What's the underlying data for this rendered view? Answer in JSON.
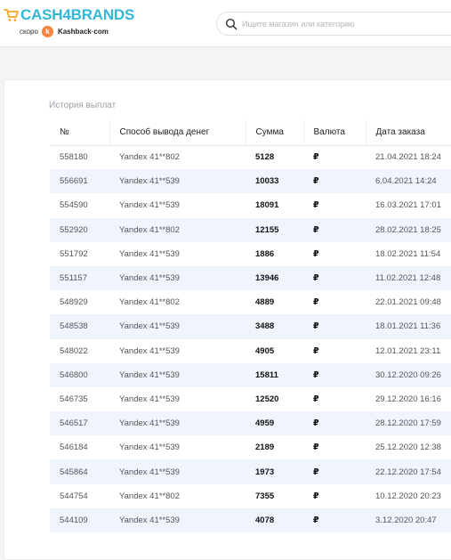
{
  "brand": {
    "name": "CASH4BRANDS",
    "soon_label": "скоро",
    "k_letter": "k",
    "kashback_label": "Kashback·com",
    "color": "#34b6d8"
  },
  "search": {
    "placeholder": "Ищите магазин или категорию"
  },
  "payouts": {
    "title": "История выплат",
    "columns": [
      "№",
      "Способ вывода денег",
      "Сумма",
      "Валюта",
      "Дата заказа"
    ],
    "rows": [
      [
        "558180",
        "Yandex 41**802",
        "5128",
        "₽",
        "21.04.2021 18:24"
      ],
      [
        "556691",
        "Yandex 41**539",
        "10033",
        "₽",
        "6.04.2021 14:24"
      ],
      [
        "554590",
        "Yandex 41**539",
        "18091",
        "₽",
        "16.03.2021 17:01"
      ],
      [
        "552920",
        "Yandex 41**802",
        "12155",
        "₽",
        "28.02.2021 18:25"
      ],
      [
        "551792",
        "Yandex 41**539",
        "1886",
        "₽",
        "18.02.2021 11:54"
      ],
      [
        "551157",
        "Yandex 41**539",
        "13946",
        "₽",
        "11.02.2021 12:48"
      ],
      [
        "548929",
        "Yandex 41**802",
        "4889",
        "₽",
        "22.01.2021 09:48"
      ],
      [
        "548538",
        "Yandex 41**539",
        "3488",
        "₽",
        "18.01.2021 11:36"
      ],
      [
        "548022",
        "Yandex 41**539",
        "4905",
        "₽",
        "12.01.2021 23:11"
      ],
      [
        "546800",
        "Yandex 41**539",
        "15811",
        "₽",
        "30.12.2020 09:26"
      ],
      [
        "546735",
        "Yandex 41**539",
        "12520",
        "₽",
        "29.12.2020 16:16"
      ],
      [
        "546517",
        "Yandex 41**539",
        "4959",
        "₽",
        "28.12.2020 17:59"
      ],
      [
        "546184",
        "Yandex 41**539",
        "2189",
        "₽",
        "25.12.2020 12:38"
      ],
      [
        "545864",
        "Yandex 41**539",
        "1973",
        "₽",
        "22.12.2020 17:54"
      ],
      [
        "544754",
        "Yandex 41**802",
        "7355",
        "₽",
        "10.12.2020 20:23"
      ],
      [
        "544109",
        "Yandex 41**539",
        "4078",
        "₽",
        "3.12.2020 20:47"
      ]
    ]
  }
}
